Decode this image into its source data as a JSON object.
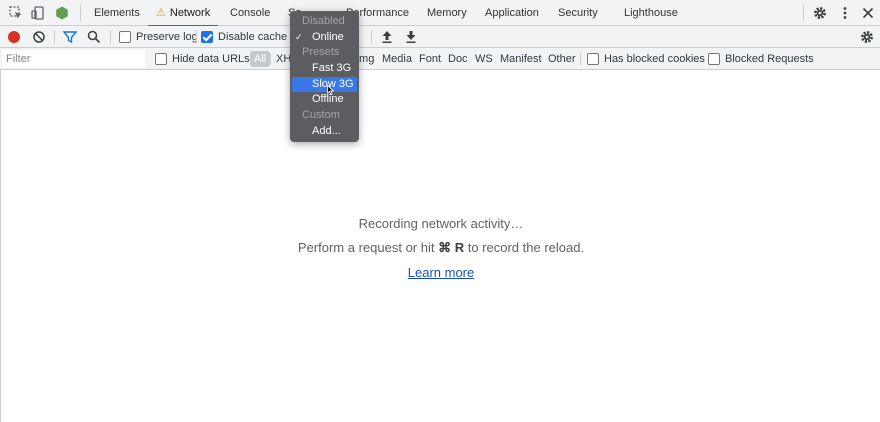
{
  "tabs": {
    "items": [
      {
        "label": "Elements"
      },
      {
        "label": "Network",
        "warning": true
      },
      {
        "label": "Console"
      },
      {
        "label": "So"
      },
      {
        "label": "Performance"
      },
      {
        "label": "Memory"
      },
      {
        "label": "Application"
      },
      {
        "label": "Security"
      },
      {
        "label": "Lighthouse"
      }
    ],
    "active": "Network"
  },
  "toolbar": {
    "preserve_log": {
      "label": "Preserve log",
      "checked": false
    },
    "disable_cache": {
      "label": "Disable cache",
      "checked": true
    }
  },
  "filterbar": {
    "filter_placeholder": "Filter",
    "hide_data_urls": {
      "label": "Hide data URLs",
      "checked": false
    },
    "types": [
      "All",
      "XH",
      "Img",
      "Media",
      "Font",
      "Doc",
      "WS",
      "Manifest",
      "Other"
    ],
    "has_blocked_cookies": {
      "label": "Has blocked cookies",
      "checked": false
    },
    "blocked_requests": {
      "label": "Blocked Requests",
      "checked": false
    }
  },
  "main": {
    "recording": "Recording network activity…",
    "hint_prefix": "Perform a request or hit",
    "hint_keys": "⌘ R",
    "hint_suffix": "to record the reload.",
    "learn_more": "Learn more"
  },
  "throttle_menu": {
    "items": [
      {
        "label": "Disabled",
        "kind": "heading"
      },
      {
        "label": "Online",
        "kind": "option",
        "checked": true
      },
      {
        "label": "Presets",
        "kind": "heading"
      },
      {
        "label": "Fast 3G",
        "kind": "option"
      },
      {
        "label": "Slow 3G",
        "kind": "option",
        "selected": true
      },
      {
        "label": "Offline",
        "kind": "option"
      },
      {
        "label": "Custom",
        "kind": "heading"
      },
      {
        "label": "Add...",
        "kind": "option"
      }
    ],
    "check_glyph": "✓"
  },
  "colors": {
    "accent": "#1a73e8",
    "record": "#d93025",
    "menu_bg": "#5b5d60",
    "menu_selected": "#3b78e7",
    "link": "#1a4fba"
  },
  "icons": [
    "inspect-icon",
    "device-toolbar-icon",
    "node-icon",
    "warning-icon",
    "gear-icon",
    "kebab-menu-icon",
    "close-icon",
    "record-icon",
    "clear-icon",
    "filter-icon",
    "search-icon",
    "upload-icon",
    "download-icon"
  ]
}
